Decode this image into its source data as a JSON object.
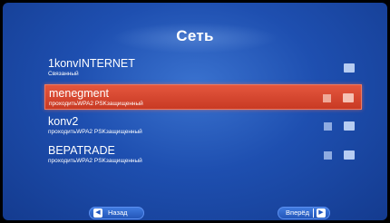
{
  "header": {
    "title": "Сеть"
  },
  "networks": [
    {
      "name": "1konvINTERNET",
      "status": "Связанный",
      "selected": false,
      "secured": false
    },
    {
      "name": "menegment",
      "status": "проходитьWPA2 PSKзащищенный",
      "selected": true,
      "secured": true
    },
    {
      "name": "konv2",
      "status": "проходитьWPA2 PSKзащищенный",
      "selected": false,
      "secured": true
    },
    {
      "name": "BEPATRADE",
      "status": "проходитьWPA2 PSKзащищенный",
      "selected": false,
      "secured": true
    }
  ],
  "footer": {
    "back_label": "Назад",
    "back_icon": "◀",
    "forward_label": "Вперёд",
    "forward_icon": "▶"
  },
  "colors": {
    "background": "#1e4fb0",
    "selected_row": "#d84a32",
    "text": "#ffffff"
  }
}
